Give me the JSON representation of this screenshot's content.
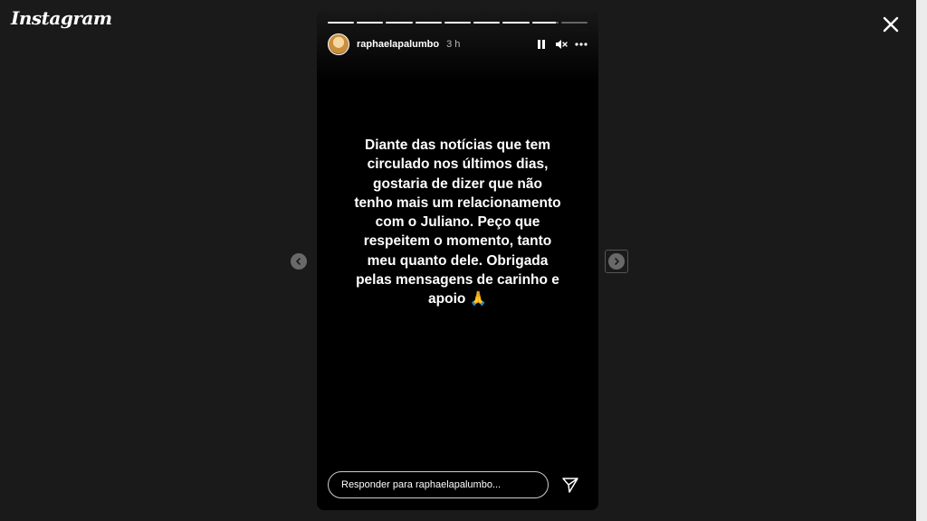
{
  "app": {
    "logo_text": "Instagram"
  },
  "story": {
    "username": "raphaelapalumbo",
    "timestamp": "3 h",
    "segments": [
      1,
      1,
      1,
      1,
      1,
      1,
      1,
      0.9,
      0
    ],
    "text": "Diante das notícias que tem circulado nos últimos dias, gostaria de dizer que não tenho mais um relacionamento com o Juliano.  Peço que respeitem o momento, tanto meu quanto dele. Obrigada pelas mensagens de carinho e apoio 🙏",
    "reply_placeholder": "Responder para raphaelapalumbo..."
  },
  "icons": {
    "close": "close-icon",
    "pause": "pause-icon",
    "mute": "mute-icon",
    "more": "more-icon",
    "prev": "chevron-left-icon",
    "next": "chevron-right-icon",
    "send": "send-icon"
  },
  "colors": {
    "background": "#1a1a1a",
    "story_bg": "#000000",
    "text": "#ffffff"
  }
}
